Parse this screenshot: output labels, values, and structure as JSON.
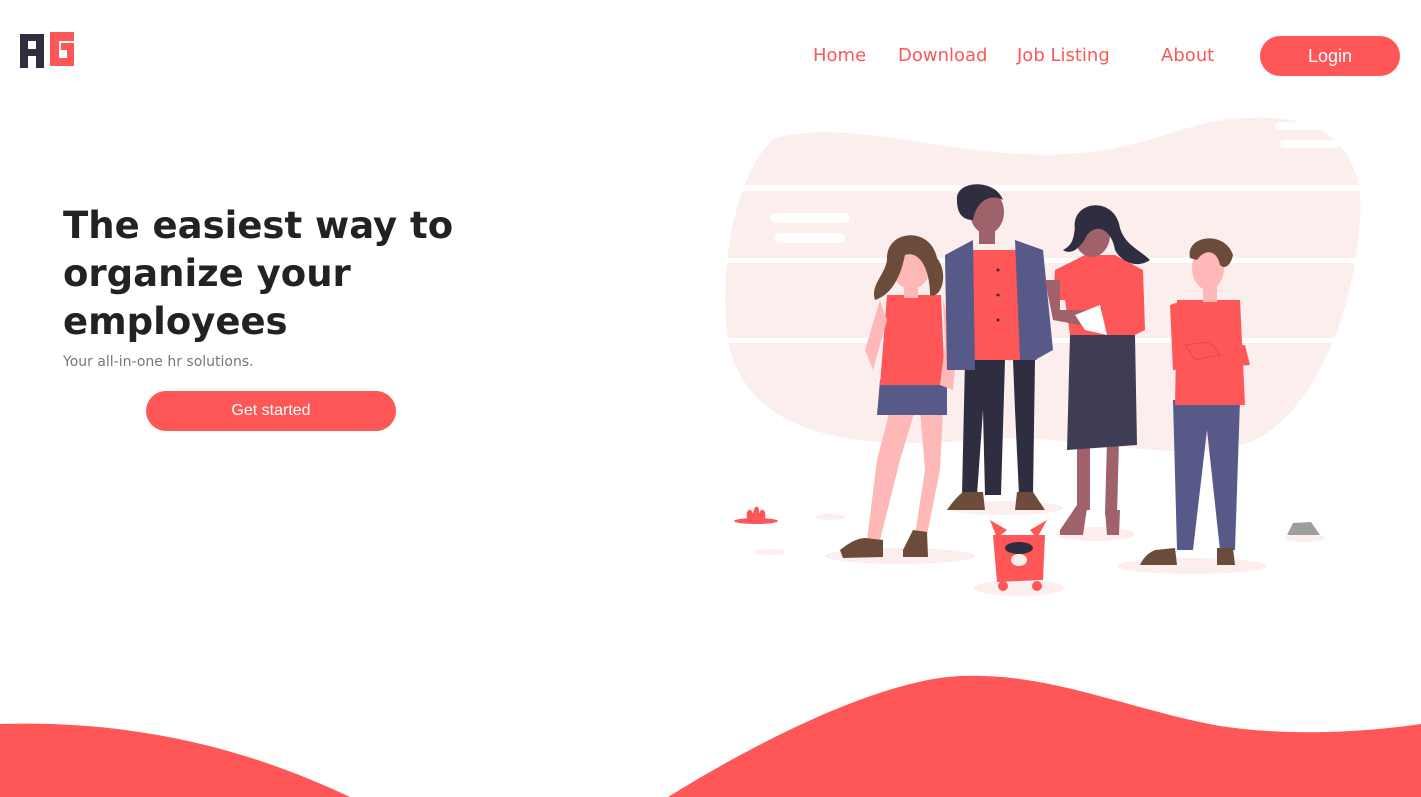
{
  "brand": {
    "logo_text": "AG",
    "primary_color": "#ff5757",
    "dark_color": "#2f2e41"
  },
  "nav": {
    "items": [
      {
        "label": "Home"
      },
      {
        "label": "Download"
      },
      {
        "label": "Job Listing"
      },
      {
        "label": "About"
      }
    ],
    "login_label": "Login"
  },
  "hero": {
    "title_lines": [
      "The easiest way to",
      "organize your",
      "employees"
    ],
    "subtitle": "Your all-in-one hr solutions.",
    "cta_label": "Get started"
  },
  "illustration": {
    "icon": "team-of-people-illustration"
  }
}
